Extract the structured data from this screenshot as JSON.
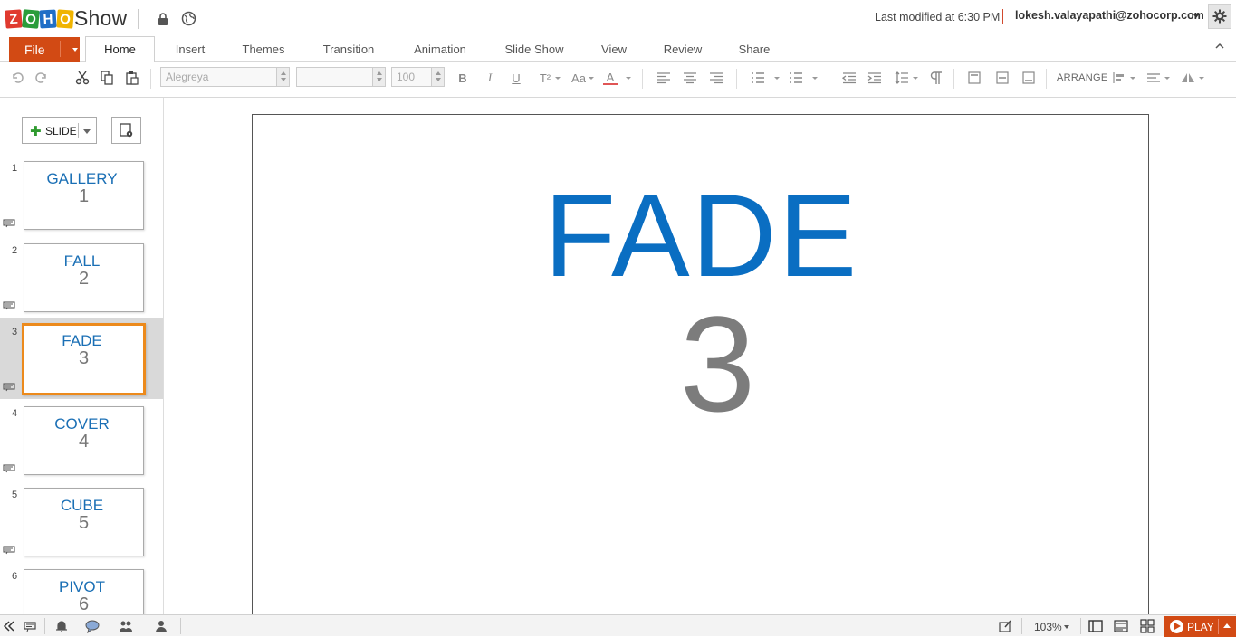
{
  "header": {
    "logo_letters": [
      "Z",
      "O",
      "H",
      "O"
    ],
    "logo_colors": [
      "#e03a2f",
      "#2a9d3a",
      "#1f6ec6",
      "#f0b400"
    ],
    "app_name": "Show",
    "last_modified": "Last modified at 6:30 PM",
    "user_email": "lokesh.valayapathi@zohocorp.com",
    "icons": [
      "lock-icon",
      "globe-icon",
      "settings-gear-icon"
    ]
  },
  "tabs": {
    "file_label": "File",
    "items": [
      {
        "label": "Home",
        "active": true
      },
      {
        "label": "Insert"
      },
      {
        "label": "Themes"
      },
      {
        "label": "Transition"
      },
      {
        "label": "Animation"
      },
      {
        "label": "Slide Show"
      },
      {
        "label": "View"
      },
      {
        "label": "Review"
      },
      {
        "label": "Share"
      }
    ]
  },
  "toolbar": {
    "font_family": "Alegreya",
    "font_size_placeholder": "",
    "opacity": "100",
    "bold": "B",
    "italic": "I",
    "underline": "U",
    "superscript": "T²",
    "case": "Aa",
    "font_color": "A",
    "arrange_label": "ARRANGE"
  },
  "sidebar": {
    "add_slide_label": "SLIDE",
    "slides": [
      {
        "num": "1",
        "title": "GALLERY",
        "subtitle": "1",
        "selected": false
      },
      {
        "num": "2",
        "title": "FALL",
        "subtitle": "2",
        "selected": false
      },
      {
        "num": "3",
        "title": "FADE",
        "subtitle": "3",
        "selected": true
      },
      {
        "num": "4",
        "title": "COVER",
        "subtitle": "4",
        "selected": false
      },
      {
        "num": "5",
        "title": "CUBE",
        "subtitle": "5",
        "selected": false
      },
      {
        "num": "6",
        "title": "PIVOT",
        "subtitle": "6",
        "selected": false
      }
    ]
  },
  "slide": {
    "title": "FADE",
    "number": "3",
    "title_color": "#0a6ec2",
    "number_color": "#7c7c7c"
  },
  "statusbar": {
    "zoom": "103%",
    "play_label": "PLAY",
    "accent": "#d24a14"
  }
}
